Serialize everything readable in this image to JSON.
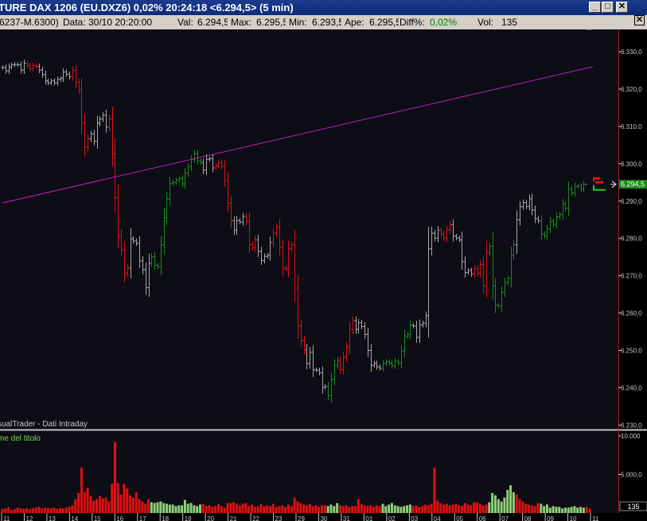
{
  "window": {
    "title": "TURE DAX 1206 (EU.DXZ6) 0,02% 20:24:18 <6.294,5> (5 min)",
    "btn_min": "_",
    "btn_max": "□",
    "btn_close": "✕"
  },
  "infobar": {
    "symbol": "6237-M.6300)",
    "data_label": "Data:",
    "data_value": "30/10 20:20:00",
    "val_label": "Val:",
    "val_value": "6.294,5",
    "max_label": "Max:",
    "max_value": "6.295,5",
    "min_label": "Min:",
    "min_value": "6.293,5",
    "ape_label": "Ape:",
    "ape_value": "6.295,5",
    "diff_label": "Diff%:",
    "diff_value": "0,02%",
    "vol_label": "Vol:",
    "vol_value": "135",
    "close": "✕"
  },
  "colors": {
    "up": "#1a8a1a",
    "down": "#e01010",
    "neutral": "#a8a8a8",
    "trendline": "#c020c0",
    "vol_up": "#8ed07a",
    "vol_down": "#e01010",
    "background": "#0d0d15"
  },
  "chart_data": [
    {
      "type": "ohlc",
      "watermark": "sualTrader - Dati Intraday",
      "ylim": [
        6229,
        6336
      ],
      "y_ticks": [
        "6.330,0",
        "6.320,0",
        "6.310,0",
        "6.300,0",
        "6.290,0",
        "6.280,0",
        "6.270,0",
        "6.260,0",
        "6.250,0",
        "6.240,0",
        "6.230,0"
      ],
      "last_price_label": "6.294,5",
      "last_price": 6294.5,
      "x_ticks": [
        "11",
        "12",
        "13",
        "14",
        "15",
        "16",
        "17",
        "18",
        "19",
        "20",
        "21",
        "22",
        "23",
        "29",
        "30",
        "31",
        "01",
        "02",
        "03",
        "04",
        "05",
        "06",
        "07",
        "08",
        "09",
        "10",
        "11"
      ],
      "trendline": [
        [
          0,
          6289.5
        ],
        [
          194,
          6326.0
        ]
      ],
      "bar_count": 194,
      "close": [
        6325.8,
        6324.9,
        6326.0,
        6326.5,
        6326.6,
        6326.5,
        6325.1,
        6326.9,
        6326.3,
        6325.5,
        6326.3,
        6326.1,
        6325.1,
        6323.9,
        6322.2,
        6321.7,
        6322.2,
        6321.7,
        6322.6,
        6322.9,
        6324.6,
        6324.0,
        6323.3,
        6325.0,
        6321.8,
        6319.8,
        6311.0,
        6304.4,
        6306.7,
        6308.0,
        6306.0,
        6310.9,
        6312.0,
        6313.0,
        6309.8,
        6312.0,
        6302.7,
        6290.9,
        6280.8,
        6276.9,
        6270.6,
        6272.1,
        6279.9,
        6279.3,
        6278.7,
        6274.0,
        6271.6,
        6266.8,
        6273.4,
        6275.1,
        6272.8,
        6272.4,
        6278.3,
        6285.6,
        6290.5,
        6294.7,
        6295.0,
        6295.6,
        6296.0,
        6294.6,
        6297.5,
        6299.2,
        6301.2,
        6302.7,
        6300.8,
        6300.3,
        6298.3,
        6301.2,
        6301.4,
        6298.9,
        6299.5,
        6300.3,
        6299.3,
        6295.5,
        6289.4,
        6284.7,
        6282.2,
        6284.8,
        6284.4,
        6285.9,
        6284.5,
        6278.4,
        6277.5,
        6279.6,
        6276.5,
        6274.1,
        6275.2,
        6275.5,
        6278.9,
        6281.4,
        6283.0,
        6277.6,
        6272.0,
        6271.8,
        6277.3,
        6278.3,
        6266.7,
        6256.6,
        6252.6,
        6250.1,
        6246.5,
        6249.5,
        6244.8,
        6244.7,
        6244.0,
        6240.1,
        6240.3,
        6237.9,
        6242.2,
        6246.0,
        6247.3,
        6244.9,
        6248.2,
        6250.9,
        6255.6,
        6257.9,
        6255.6,
        6257.4,
        6256.4,
        6254.3,
        6250.0,
        6246.0,
        6246.5,
        6245.6,
        6245.2,
        6246.5,
        6247.0,
        6246.6,
        6245.9,
        6247.1,
        6246.6,
        6249.8,
        6253.8,
        6254.3,
        6256.7,
        6256.5,
        6253.5,
        6256.8,
        6257.3,
        6259.3,
        6277.2,
        6281.4,
        6280.1,
        6282.2,
        6281.2,
        6280.1,
        6282.2,
        6283.7,
        6280.6,
        6280.1,
        6279.6,
        6273.8,
        6270.9,
        6271.4,
        6270.5,
        6271.9,
        6270.7,
        6273.0,
        6267.3,
        6276.2,
        6277.9,
        6267.3,
        6262.1,
        6261.9,
        6265.5,
        6268.2,
        6269.3,
        6275.5,
        6278.3,
        6285.0,
        6288.5,
        6289.6,
        6288.6,
        6290.6,
        6287.6,
        6285.3,
        6284.7,
        6281.2,
        6280.6,
        6282.5,
        6284.6,
        6283.8,
        6285.8,
        6286.4,
        6289.2,
        6288.1,
        6293.2,
        6292.2,
        6293.9,
        6294.0,
        6293.3,
        6294.5
      ],
      "direction": "u=up d=down n=neutral",
      "bar_colors": "nnnnnnnnddddnnnnnnnnnnnddddddnnnnnndddddddnnnnnnnuuuuuuuuuuuuuuuuunnnnddddddnnnnddddnnnnndddddddddddnnnnnnnuuuudddddnnnnnnnnnuuuuuuuuuunnnnnnnnnddddnnnnnnnddddduuuuuuuuunnnnnnnnuuuuuuuuuuuuuuu"
    },
    {
      "type": "bar",
      "title": "me del titolo",
      "ylim": [
        0,
        10000
      ],
      "y_ticks": [
        "10.000",
        "5.000,0"
      ],
      "last_volume_label": "135",
      "volume": [
        500,
        600,
        750,
        400,
        500,
        700,
        600,
        550,
        600,
        500,
        650,
        700,
        800,
        600,
        700,
        650,
        600,
        700,
        550,
        650,
        600,
        700,
        800,
        1000,
        1800,
        2600,
        5900,
        2700,
        3300,
        2200,
        1600,
        1800,
        2200,
        1900,
        2000,
        1500,
        3800,
        9200,
        3900,
        2400,
        3800,
        3200,
        2300,
        2000,
        2700,
        1800,
        1500,
        1200,
        1800,
        1400,
        1300,
        1400,
        1500,
        1300,
        1200,
        1100,
        1100,
        900,
        1000,
        1000,
        1700,
        1200,
        1300,
        1000,
        900,
        1100,
        1200,
        900,
        1000,
        800,
        900,
        1200,
        900,
        700,
        1300,
        1300,
        1400,
        1200,
        1000,
        1200,
        1300,
        900,
        1100,
        800,
        900,
        1200,
        900,
        1000,
        900,
        1200,
        800,
        900,
        1000,
        800,
        1100,
        900,
        2000,
        1500,
        1300,
        1100,
        1000,
        1200,
        900,
        1000,
        800,
        1000,
        1000,
        900,
        1100,
        900,
        1300,
        1000,
        900,
        1000,
        800,
        900,
        900,
        1800,
        1200,
        1000,
        900,
        1000,
        800,
        1000,
        900,
        1200,
        900,
        1100,
        1300,
        1000,
        900,
        800,
        900,
        1000,
        1100,
        900,
        1000,
        800,
        900,
        1100,
        1000,
        1200,
        5900,
        1600,
        1300,
        1100,
        1200,
        1000,
        1100,
        1200,
        1000,
        900,
        1300,
        1100,
        1000,
        1400,
        1400,
        1200,
        1000,
        1100,
        1400,
        2600,
        2300,
        1800,
        1500,
        2000,
        3000,
        3600,
        2700,
        2400,
        1800,
        1500,
        1200,
        1100,
        1000,
        900,
        1300,
        1200,
        900,
        1100,
        700,
        900,
        800,
        800,
        600,
        700,
        700,
        800,
        900,
        700,
        800,
        700,
        800,
        600,
        700
      ]
    }
  ]
}
